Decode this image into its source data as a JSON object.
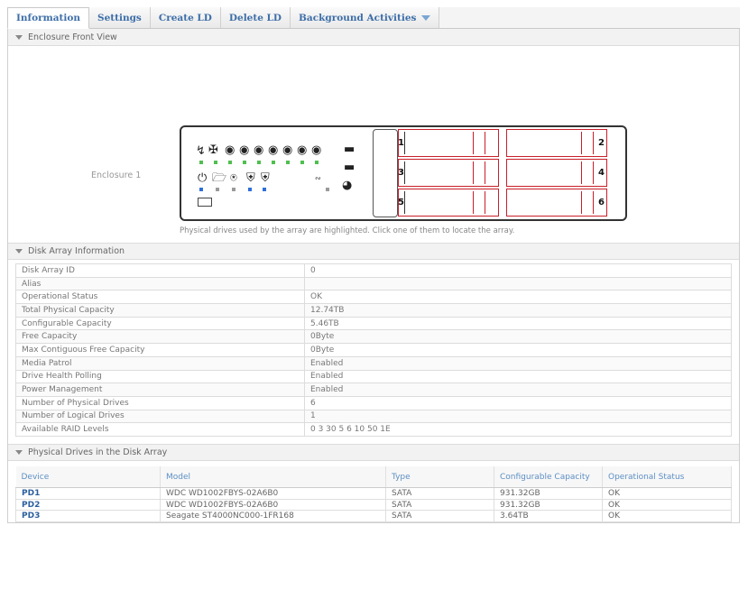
{
  "tabs": [
    {
      "label": "Information"
    },
    {
      "label": "Settings"
    },
    {
      "label": "Create LD"
    },
    {
      "label": "Delete LD"
    },
    {
      "label": "Background Activities"
    }
  ],
  "enclosure_section": {
    "title": "Enclosure Front View",
    "enclosure_label": "Enclosure 1",
    "bays": [
      "1",
      "2",
      "3",
      "4",
      "5",
      "6"
    ],
    "hint": "Physical drives used by the array are highlighted. Click one of them to locate the array."
  },
  "disk_array_section": {
    "title": "Disk Array Information",
    "rows": [
      {
        "key": "Disk Array ID",
        "value": "0"
      },
      {
        "key": "Alias",
        "value": ""
      },
      {
        "key": "Operational Status",
        "value": "OK"
      },
      {
        "key": "Total Physical Capacity",
        "value": "12.74TB"
      },
      {
        "key": "Configurable Capacity",
        "value": "5.46TB"
      },
      {
        "key": "Free Capacity",
        "value": "0Byte"
      },
      {
        "key": "Max Contiguous Free Capacity",
        "value": "0Byte"
      },
      {
        "key": "Media Patrol",
        "value": "Enabled"
      },
      {
        "key": "Drive Health Polling",
        "value": "Enabled"
      },
      {
        "key": "Power Management",
        "value": "Enabled"
      },
      {
        "key": "Number of Physical Drives",
        "value": "6"
      },
      {
        "key": "Number of Logical Drives",
        "value": "1"
      },
      {
        "key": "Available RAID Levels",
        "value": "0 3 30 5 6 10 50 1E"
      }
    ]
  },
  "physical_drives_section": {
    "title": "Physical Drives in the Disk Array",
    "columns": [
      "Device",
      "Model",
      "Type",
      "Configurable Capacity",
      "Operational Status"
    ],
    "rows": [
      [
        "PD1",
        "WDC WD1002FBYS-02A6B0",
        "SATA",
        "931.32GB",
        "OK"
      ],
      [
        "PD2",
        "WDC WD1002FBYS-02A6B0",
        "SATA",
        "931.32GB",
        "OK"
      ],
      [
        "PD3",
        "Seagate ST4000NC000-1FR168",
        "SATA",
        "3.64TB",
        "OK"
      ]
    ]
  }
}
